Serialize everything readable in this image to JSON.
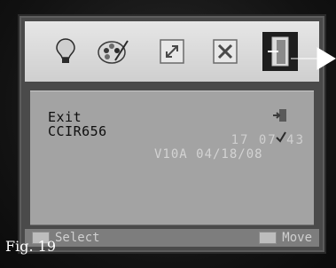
{
  "osd": {
    "menu_icons": [
      {
        "name": "lightbulb-icon"
      },
      {
        "name": "palette-icon"
      },
      {
        "name": "resize-icon"
      },
      {
        "name": "tools-icon"
      },
      {
        "name": "exit-door-icon",
        "selected": true
      }
    ],
    "content": {
      "title": "Exit",
      "subtitle": "CCIR656"
    },
    "clock": "17 07 43",
    "version": "V10A 04/18/08",
    "status_bar": {
      "left_label": "Select",
      "right_label": "Move"
    }
  },
  "figure_label": "Fig. 19",
  "colors": {
    "osd_background": "#a3a3a3",
    "icon_bar": "#d9d9d9",
    "selected_icon_background": "#1e1e1e"
  }
}
